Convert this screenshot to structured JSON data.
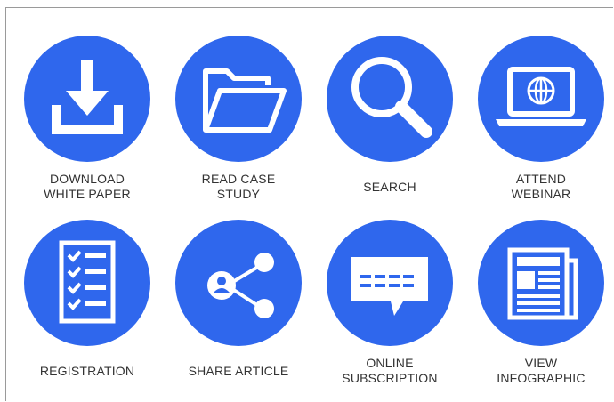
{
  "colors": {
    "icon_circle": "#2f67ed",
    "icon_glyph": "#ffffff",
    "label_text": "#333333"
  },
  "tiles": [
    {
      "label": "DOWNLOAD\nWHITE PAPER",
      "icon": "download-icon"
    },
    {
      "label": "READ CASE\nSTUDY",
      "icon": "folder-icon"
    },
    {
      "label": "SEARCH",
      "icon": "magnifier-icon"
    },
    {
      "label": "ATTEND\nWEBINAR",
      "icon": "laptop-globe-icon"
    },
    {
      "label": "REGISTRATION",
      "icon": "checklist-icon"
    },
    {
      "label": "SHARE ARTICLE",
      "icon": "share-icon"
    },
    {
      "label": "ONLINE\nSUBSCRIPTION",
      "icon": "message-bubble-icon"
    },
    {
      "label": "VIEW\nINFOGRAPHIC",
      "icon": "newspaper-icon"
    }
  ]
}
